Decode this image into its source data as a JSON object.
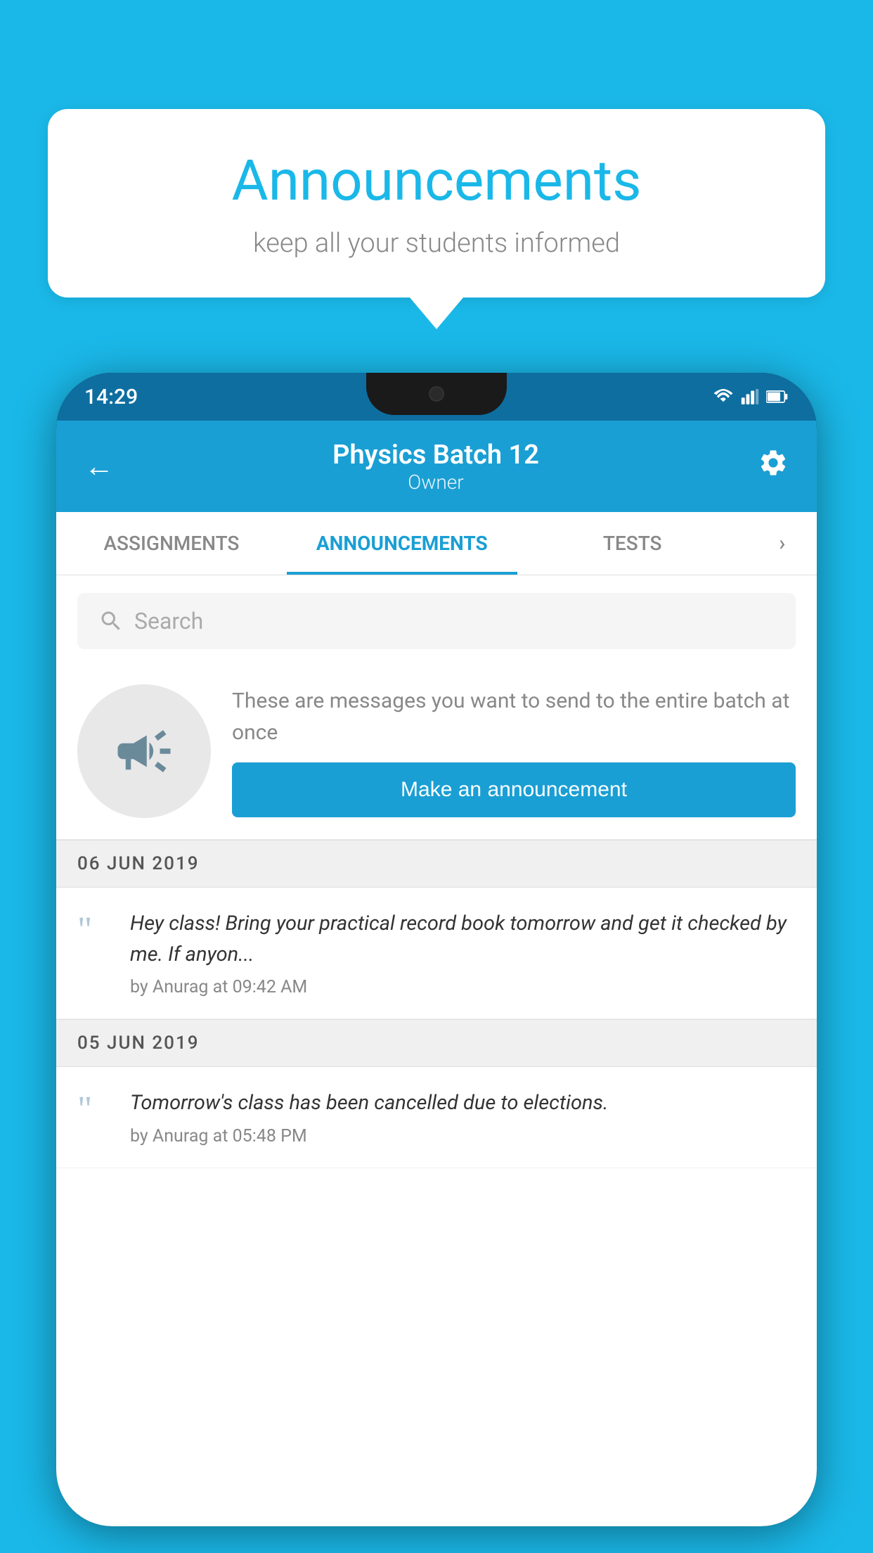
{
  "background_color": "#1ab8e8",
  "speech_bubble": {
    "title": "Announcements",
    "subtitle": "keep all your students informed"
  },
  "phone": {
    "status_bar": {
      "time": "14:29",
      "wifi": "▾",
      "signal": "▴",
      "battery": "▮"
    },
    "header": {
      "back_label": "←",
      "title": "Physics Batch 12",
      "subtitle": "Owner",
      "settings_label": "⚙"
    },
    "tabs": [
      {
        "label": "ASSIGNMENTS",
        "active": false
      },
      {
        "label": "ANNOUNCEMENTS",
        "active": true
      },
      {
        "label": "TESTS",
        "active": false
      },
      {
        "label": "›",
        "active": false
      }
    ],
    "search": {
      "placeholder": "Search"
    },
    "promo": {
      "description": "These are messages you want to send to the entire batch at once",
      "button_label": "Make an announcement"
    },
    "announcements": [
      {
        "date": "06  JUN  2019",
        "text": "Hey class! Bring your practical record book tomorrow and get it checked by me. If anyon...",
        "meta": "by Anurag at 09:42 AM"
      },
      {
        "date": "05  JUN  2019",
        "text": "Tomorrow's class has been cancelled due to elections.",
        "meta": "by Anurag at 05:48 PM"
      }
    ]
  }
}
